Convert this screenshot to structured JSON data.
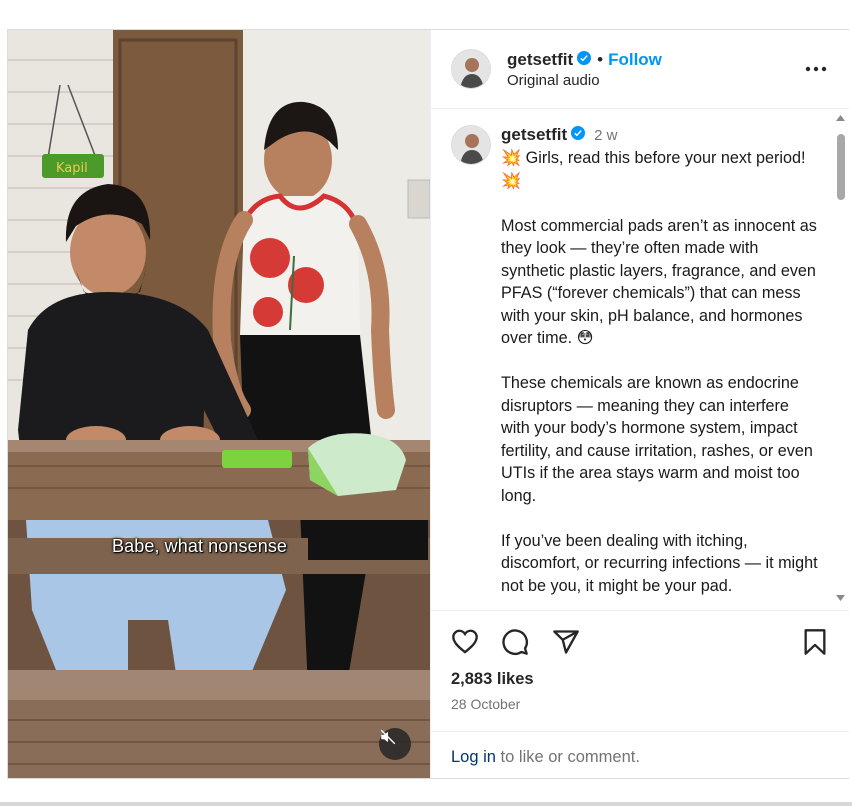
{
  "post": {
    "username": "getsetfit",
    "follow_label": "Follow",
    "audio_label": "Original audio",
    "separator": "•"
  },
  "media": {
    "caption": "Babe, what nonsense",
    "sign_text": "Kapil",
    "muted": true,
    "mute_icon": "speaker-muted-icon"
  },
  "caption": {
    "username": "getsetfit",
    "time_ago": "2 w",
    "paragraphs": [
      "💥 Girls, read this before your next period! 💥",
      "Most commercial pads aren’t as innocent as they look — they’re often made with synthetic plastic layers, fragrance, and even PFAS (“forever chemicals”) that can mess with your skin, pH balance, and hormones over time. 😳",
      "These chemicals are known as endocrine disruptors — meaning they can interfere with your body’s hormone system, impact fertility, and cause irritation, rashes, or even UTIs if the area stays warm and moist too long.",
      "If you’ve been dealing with itching, discomfort, or recurring infections — it might not be you, it might be your pad."
    ]
  },
  "stats": {
    "likes": "2,883 likes",
    "date": "28 October"
  },
  "footer": {
    "login_link": "Log in",
    "login_rest": " to like or comment."
  },
  "icons": {
    "verified": "verified-badge-icon",
    "more": "more-options-icon",
    "like": "heart-icon",
    "comment": "comment-bubble-icon",
    "share": "send-paper-plane-icon",
    "save": "bookmark-icon"
  },
  "colors": {
    "accent": "#0095f6",
    "link_dark": "#00376b",
    "muted_text": "#737373",
    "verified": "#0095f6"
  }
}
